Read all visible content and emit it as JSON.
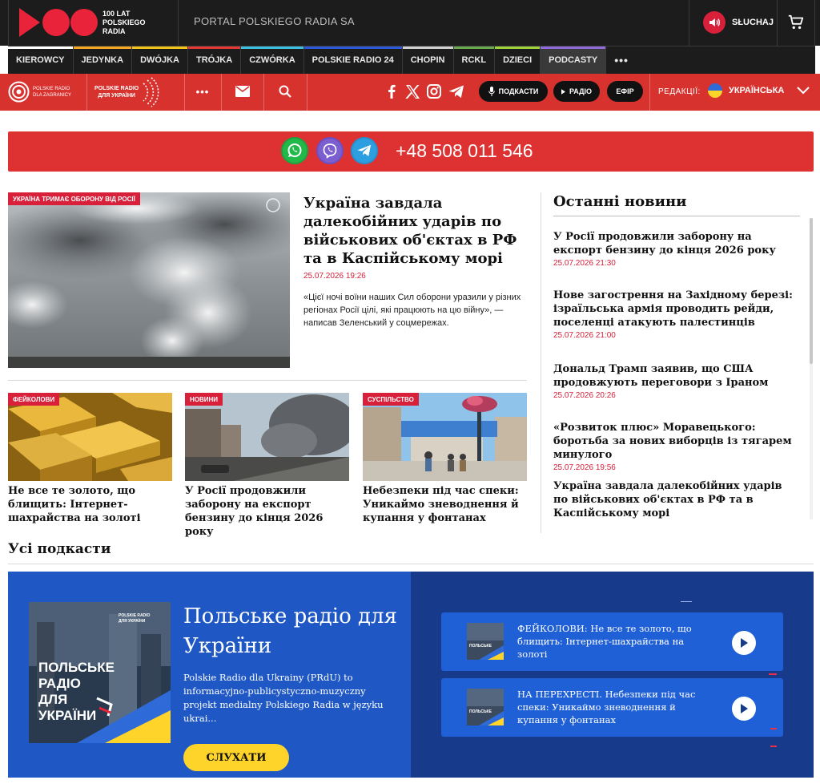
{
  "header": {
    "logo_text": "100 LAT\nPOLSKIEGO\nRADIA",
    "portal_title": "PORTAL POLSKIEGO RADIA SA",
    "listen_label": "SŁUCHAJ",
    "listen_icon": "speaker-icon",
    "cart_icon": "cart-icon",
    "brand_color": "#d8203a"
  },
  "stations": [
    {
      "label": "KIEROWCY",
      "color": "#ffffff"
    },
    {
      "label": "JEDYNKA",
      "color": "#f5a623"
    },
    {
      "label": "DWÓJKA",
      "color": "#f0c419"
    },
    {
      "label": "TRÓJKA",
      "color": "#e53935"
    },
    {
      "label": "CZWÓRKA",
      "color": "#3ec1e0"
    },
    {
      "label": "POLSKIE RADIO 24",
      "color": "#2e5ad8"
    },
    {
      "label": "CHOPIN",
      "color": "#cfcfcf"
    },
    {
      "label": "RCKL",
      "color": "#6aa84f"
    },
    {
      "label": "DZIECI",
      "color": "#9fd23c"
    },
    {
      "label": "PODCASTY",
      "color": "#8e6bd8"
    },
    {
      "label": "•••",
      "color": ""
    }
  ],
  "rednav": {
    "pr_logo_text": "POLSKIE RADIO\nDLA ZAGRANICY",
    "pru_logo_text": "POLSKIE RADIO\nДЛЯ УКРАЇНИ",
    "more_label": "•••",
    "mail_icon": "mail-icon",
    "search_icon": "search-icon",
    "social": [
      "facebook-icon",
      "x-icon",
      "instagram-icon",
      "telegram-icon"
    ],
    "pill_podcasts": "ПОДКАСТИ",
    "pill_radio": "РАДІО",
    "pill_air": "ЕФІР",
    "editions_label": "РЕДАКЦІЇ:",
    "language": "УКРАЇНСЬКА"
  },
  "contact": {
    "icons": [
      "whatsapp-icon",
      "viber-icon",
      "telegram-icon"
    ],
    "phone": "+48 508 011 546"
  },
  "main_story": {
    "tag": "УКРАЇНА ТРИМАЄ ОБОРОНУ ВІД РОСІЇ",
    "title": "Україна завдала далекобійних ударів по військових об'єктах в РФ та в Каспійському морі",
    "date": "25.07.2026 19:26",
    "lead": "«Цієї ночі воїни наших Сил оборони уразили у різних регіонах Росії цілі, які працюють на цю війну», — написав Зеленський у соцмережах."
  },
  "cards": [
    {
      "tag": "ФЕЙКОЛОВИ",
      "title": "Не все те золото, що блищить: Інтернет-шахрайства на золоті"
    },
    {
      "tag": "НОВИНИ",
      "title": "У Росії продовжили заборону на експорт бензину до кінця 2026 року"
    },
    {
      "tag": "СУСПІЛЬСТВО",
      "title": "Небезпеки під час спеки: Уникаймо зневоднення й купання у фонтанах"
    }
  ],
  "latest": {
    "heading": "Останні новини",
    "items": [
      {
        "title": "У Росії продовжили заборону на експорт бензину до кінця 2026 року",
        "date": "25.07.2026 21:30"
      },
      {
        "title": "Нове загострення на Західному березі: ізраїльська армія проводить рейди, поселенці атакують палестинців",
        "date": "25.07.2026 21:00"
      },
      {
        "title": "Дональд Трамп заявив, що США продовжують переговори з Іраном",
        "date": "25.07.2026 20:26"
      },
      {
        "title": "«Розвиток плюс» Моравецького: боротьба за нових виборців із тягарем минулого",
        "date": "25.07.2026 19:56"
      },
      {
        "title": "Україна завдала далекобійних ударів по військових об'єктах в РФ та в Каспійському морі",
        "date": ""
      }
    ]
  },
  "podcasts": {
    "heading": "Усі подкасти",
    "title": "Польське радіо для України",
    "description": "Polskie Radio dla Ukrainy (PRdU) to informacyjno-publicystyczno-muzyczny projekt medialny Polskiego Radia w języku ukrai...",
    "listen_button": "СЛУХАТИ",
    "cover_text": "ПОЛЬСЬКЕ\nРАДІО\nДЛЯ\nУКРАЇНИ",
    "cover_logo": "POLSKIE RADIO\nДЛЯ УКРАЇНИ",
    "episodes": [
      {
        "text": "ФЕЙКОЛОВИ: Не все те золото, що блищить: Інтернет-шахрайства на золоті"
      },
      {
        "text": "НА ПЕРЕХРЕСТІ. Небезпеки під час спеки: Уникаймо зневоднення й купання у фонтанах"
      }
    ]
  }
}
